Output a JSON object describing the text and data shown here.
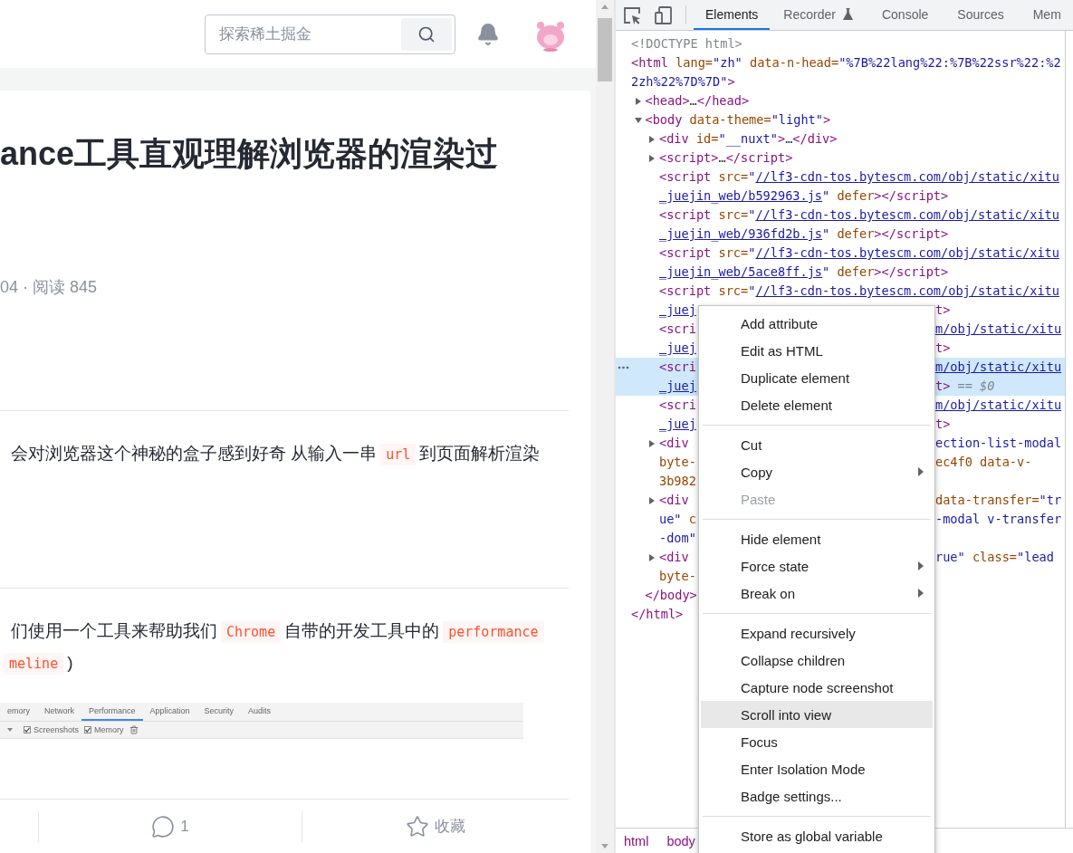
{
  "page": {
    "search": {
      "placeholder": "探索稀土掘金"
    },
    "article": {
      "title": "ance工具直观理解浏览器的渲染过",
      "meta": "04 · 阅读 845",
      "paragraphs": [
        {
          "lines": [
            [
              {
                "kind": "text",
                "text": "会对浏览器这个神秘的盒子感到好奇 从输入一串"
              },
              {
                "kind": "code",
                "text": "url"
              },
              {
                "kind": "text",
                "text": "到页面解析渲染"
              }
            ]
          ]
        },
        {
          "lines": [
            [
              {
                "kind": "text",
                "text": "们使用一个工具来帮助我们"
              },
              {
                "kind": "code",
                "text": "Chrome"
              },
              {
                "kind": "text",
                "text": "自带的开发工具中的"
              },
              {
                "kind": "code",
                "text": "performance"
              }
            ],
            [
              {
                "kind": "code",
                "text": "meline"
              },
              {
                "kind": "text",
                "text": ")"
              }
            ]
          ]
        }
      ],
      "embedded_screenshot": {
        "tabs": [
          {
            "label": "emory",
            "selected": false
          },
          {
            "label": "Network",
            "selected": false
          },
          {
            "label": "Performance",
            "selected": true
          },
          {
            "label": "Application",
            "selected": false
          },
          {
            "label": "Security",
            "selected": false
          },
          {
            "label": "Audits",
            "selected": false
          }
        ],
        "options": [
          {
            "label": "Screenshots",
            "checked": true
          },
          {
            "label": "Memory",
            "checked": true
          }
        ]
      },
      "footer": {
        "comments": "1",
        "collect": "收藏"
      }
    }
  },
  "devtools": {
    "tabs": [
      {
        "label": "Elements",
        "selected": true,
        "kind": "plain"
      },
      {
        "label": "Recorder",
        "selected": false,
        "kind": "experimental"
      },
      {
        "label": "Console",
        "selected": false,
        "kind": "plain"
      },
      {
        "label": "Sources",
        "selected": false,
        "kind": "plain"
      },
      {
        "label": "Mem",
        "selected": false,
        "kind": "plain"
      }
    ],
    "tree": [
      {
        "selected": false,
        "lines": [
          {
            "text": [
              {
                "kind": "doctype",
                "text": "<!DOCTYPE html>"
              }
            ]
          }
        ]
      },
      {
        "selected": false,
        "lines": [
          {
            "text": [
              {
                "kind": "tag",
                "text": "<html"
              },
              {
                "kind": "attr",
                "text": " lang="
              },
              {
                "kind": "value",
                "text": "\"zh\""
              },
              {
                "kind": "attr",
                "text": " data-n-head="
              },
              {
                "kind": "value",
                "text": "\"%7B%22lang%22:%7B%22ssr%22:%2"
              }
            ]
          },
          {
            "text": [
              {
                "kind": "value",
                "text": "2zh%22%7D%7D\""
              },
              {
                "kind": "tag",
                "text": ">"
              }
            ]
          }
        ],
        "children": [
          {
            "expanded": false,
            "selected": false,
            "lines": [
              {
                "text": [
                  {
                    "kind": "tag",
                    "text": "<head>"
                  },
                  {
                    "kind": "plain",
                    "text": "…"
                  },
                  {
                    "kind": "tag",
                    "text": "</head>"
                  }
                ]
              }
            ]
          },
          {
            "expanded": true,
            "selected": false,
            "lines": [
              {
                "text": [
                  {
                    "kind": "tag",
                    "text": "<body"
                  },
                  {
                    "kind": "attr",
                    "text": " data-theme="
                  },
                  {
                    "kind": "value",
                    "text": "\"light\""
                  },
                  {
                    "kind": "tag",
                    "text": ">"
                  }
                ]
              }
            ],
            "children": [
              {
                "expanded": false,
                "selected": false,
                "lines": [
                  {
                    "text": [
                      {
                        "kind": "tag",
                        "text": "<div"
                      },
                      {
                        "kind": "attr",
                        "text": " id="
                      },
                      {
                        "kind": "value",
                        "text": "\"__nuxt\""
                      },
                      {
                        "kind": "tag",
                        "text": ">"
                      },
                      {
                        "kind": "plain",
                        "text": "…"
                      },
                      {
                        "kind": "tag",
                        "text": "</div>"
                      }
                    ]
                  }
                ]
              },
              {
                "expanded": false,
                "selected": false,
                "lines": [
                  {
                    "text": [
                      {
                        "kind": "tag",
                        "text": "<script>"
                      },
                      {
                        "kind": "plain",
                        "text": "…"
                      },
                      {
                        "kind": "tag",
                        "text": "</script>"
                      }
                    ]
                  }
                ]
              },
              {
                "selected": false,
                "lines": [
                  {
                    "text": [
                      {
                        "kind": "tag",
                        "text": "<script"
                      },
                      {
                        "kind": "attr",
                        "text": " src="
                      },
                      {
                        "kind": "value",
                        "text": "\""
                      },
                      {
                        "kind": "link",
                        "text": "//lf3-cdn-tos.bytescm.com/obj/static/xitu"
                      }
                    ]
                  },
                  {
                    "text": [
                      {
                        "kind": "link",
                        "text": "_juejin_web/b592963.js"
                      },
                      {
                        "kind": "value",
                        "text": "\""
                      },
                      {
                        "kind": "attr",
                        "text": " defer"
                      },
                      {
                        "kind": "tag",
                        "text": "></script>"
                      }
                    ]
                  }
                ]
              },
              {
                "selected": false,
                "lines": [
                  {
                    "text": [
                      {
                        "kind": "tag",
                        "text": "<script"
                      },
                      {
                        "kind": "attr",
                        "text": " src="
                      },
                      {
                        "kind": "value",
                        "text": "\""
                      },
                      {
                        "kind": "link",
                        "text": "//lf3-cdn-tos.bytescm.com/obj/static/xitu"
                      }
                    ]
                  },
                  {
                    "text": [
                      {
                        "kind": "link",
                        "text": "_juejin_web/936fd2b.js"
                      },
                      {
                        "kind": "value",
                        "text": "\""
                      },
                      {
                        "kind": "attr",
                        "text": " defer"
                      },
                      {
                        "kind": "tag",
                        "text": "></script>"
                      }
                    ]
                  }
                ]
              },
              {
                "selected": false,
                "lines": [
                  {
                    "text": [
                      {
                        "kind": "tag",
                        "text": "<script"
                      },
                      {
                        "kind": "attr",
                        "text": " src="
                      },
                      {
                        "kind": "value",
                        "text": "\""
                      },
                      {
                        "kind": "link",
                        "text": "//lf3-cdn-tos.bytescm.com/obj/static/xitu"
                      }
                    ]
                  },
                  {
                    "text": [
                      {
                        "kind": "link",
                        "text": "_juejin_web/5ace8ff.js"
                      },
                      {
                        "kind": "value",
                        "text": "\""
                      },
                      {
                        "kind": "attr",
                        "text": " defer"
                      },
                      {
                        "kind": "tag",
                        "text": "></script>"
                      }
                    ]
                  }
                ]
              },
              {
                "selected": false,
                "lines": [
                  {
                    "text": [
                      {
                        "kind": "tag",
                        "text": "<script"
                      },
                      {
                        "kind": "attr",
                        "text": " src="
                      },
                      {
                        "kind": "value",
                        "text": "\""
                      },
                      {
                        "kind": "link",
                        "text": "//lf3-cdn-tos.bytescm.com/obj/static/xitu"
                      }
                    ]
                  },
                  {
                    "text": [
                      {
                        "kind": "link",
                        "text": "_juej"
                      }
                    ],
                    "past_menu": [
                      {
                        "kind": "tag",
                        "text": "t>"
                      }
                    ]
                  }
                ]
              },
              {
                "selected": false,
                "lines": [
                  {
                    "text": [
                      {
                        "kind": "tag",
                        "text": "<scri"
                      }
                    ],
                    "past_menu": [
                      {
                        "kind": "link",
                        "text": "m/obj/static/xitu"
                      }
                    ]
                  },
                  {
                    "text": [
                      {
                        "kind": "link",
                        "text": "_juej"
                      }
                    ],
                    "past_menu": [
                      {
                        "kind": "tag",
                        "text": "t>"
                      }
                    ]
                  }
                ]
              },
              {
                "selected": true,
                "lines": [
                  {
                    "text": [
                      {
                        "kind": "tag",
                        "text": "<scri"
                      }
                    ],
                    "past_menu": [
                      {
                        "kind": "link",
                        "text": "m/obj/static/xitu"
                      }
                    ]
                  },
                  {
                    "text": [
                      {
                        "kind": "link",
                        "text": "_juej"
                      }
                    ],
                    "past_menu": [
                      {
                        "kind": "tag",
                        "text": "t>"
                      },
                      {
                        "kind": "marker",
                        "text": " == $0"
                      }
                    ]
                  }
                ]
              },
              {
                "selected": false,
                "lines": [
                  {
                    "text": [
                      {
                        "kind": "tag",
                        "text": "<scri"
                      }
                    ],
                    "past_menu": [
                      {
                        "kind": "link",
                        "text": "m/obj/static/xitu"
                      }
                    ]
                  },
                  {
                    "text": [
                      {
                        "kind": "link",
                        "text": "_juej"
                      }
                    ],
                    "past_menu": [
                      {
                        "kind": "tag",
                        "text": "t>"
                      }
                    ]
                  }
                ]
              },
              {
                "expanded": false,
                "selected": false,
                "lines": [
                  {
                    "text": [
                      {
                        "kind": "tag",
                        "text": "<div"
                      }
                    ],
                    "past_menu": [
                      {
                        "kind": "value",
                        "text": "ection-list-modal"
                      }
                    ]
                  },
                  {
                    "text": [
                      {
                        "kind": "attr",
                        "text": "byte-"
                      }
                    ],
                    "past_menu": [
                      {
                        "kind": "attr",
                        "text": "ec4f0 data-v-"
                      }
                    ]
                  },
                  {
                    "text": [
                      {
                        "kind": "attr",
                        "text": "3b982"
                      }
                    ]
                  }
                ]
              },
              {
                "expanded": false,
                "selected": false,
                "lines": [
                  {
                    "text": [
                      {
                        "kind": "tag",
                        "text": "<div"
                      }
                    ],
                    "past_menu": [
                      {
                        "kind": "attr",
                        "text": "data-transfer="
                      },
                      {
                        "kind": "value",
                        "text": "\"tr"
                      }
                    ]
                  },
                  {
                    "text": [
                      {
                        "kind": "value",
                        "text": "ue\""
                      },
                      {
                        "kind": "attr",
                        "text": " c"
                      }
                    ],
                    "past_menu": [
                      {
                        "kind": "value",
                        "text": "-modal v-transfer"
                      }
                    ]
                  },
                  {
                    "text": [
                      {
                        "kind": "value",
                        "text": "-dom\""
                      }
                    ]
                  }
                ]
              },
              {
                "expanded": false,
                "selected": false,
                "lines": [
                  {
                    "text": [
                      {
                        "kind": "tag",
                        "text": "<div"
                      }
                    ],
                    "past_menu": [
                      {
                        "kind": "value",
                        "text": "rue\""
                      },
                      {
                        "kind": "attr",
                        "text": " class="
                      },
                      {
                        "kind": "value",
                        "text": "\"lead"
                      }
                    ]
                  },
                  {
                    "text": [
                      {
                        "kind": "attr",
                        "text": "byte-"
                      }
                    ]
                  }
                ]
              }
            ],
            "closing": [
              {
                "kind": "tag",
                "text": "</body>"
              }
            ]
          }
        ],
        "closing": [
          {
            "kind": "tag",
            "text": "</html>"
          }
        ]
      }
    ],
    "breadcrumbs": [
      "html",
      "body"
    ],
    "context_menu": [
      {
        "kind": "item",
        "label": "Add attribute",
        "submenu": false,
        "disabled": false,
        "selected": false
      },
      {
        "kind": "item",
        "label": "Edit as HTML",
        "submenu": false,
        "disabled": false,
        "selected": false
      },
      {
        "kind": "item",
        "label": "Duplicate element",
        "submenu": false,
        "disabled": false,
        "selected": false
      },
      {
        "kind": "item",
        "label": "Delete element",
        "submenu": false,
        "disabled": false,
        "selected": false
      },
      {
        "kind": "separator"
      },
      {
        "kind": "item",
        "label": "Cut",
        "submenu": false,
        "disabled": false,
        "selected": false
      },
      {
        "kind": "item",
        "label": "Copy",
        "submenu": true,
        "disabled": false,
        "selected": false
      },
      {
        "kind": "item",
        "label": "Paste",
        "submenu": false,
        "disabled": true,
        "selected": false
      },
      {
        "kind": "separator"
      },
      {
        "kind": "item",
        "label": "Hide element",
        "submenu": false,
        "disabled": false,
        "selected": false
      },
      {
        "kind": "item",
        "label": "Force state",
        "submenu": true,
        "disabled": false,
        "selected": false
      },
      {
        "kind": "item",
        "label": "Break on",
        "submenu": true,
        "disabled": false,
        "selected": false
      },
      {
        "kind": "separator"
      },
      {
        "kind": "item",
        "label": "Expand recursively",
        "submenu": false,
        "disabled": false,
        "selected": false
      },
      {
        "kind": "item",
        "label": "Collapse children",
        "submenu": false,
        "disabled": false,
        "selected": false
      },
      {
        "kind": "item",
        "label": "Capture node screenshot",
        "submenu": false,
        "disabled": false,
        "selected": false
      },
      {
        "kind": "item",
        "label": "Scroll into view",
        "submenu": false,
        "disabled": false,
        "selected": true
      },
      {
        "kind": "item",
        "label": "Focus",
        "submenu": false,
        "disabled": false,
        "selected": false
      },
      {
        "kind": "item",
        "label": "Enter Isolation Mode",
        "submenu": false,
        "disabled": false,
        "selected": false
      },
      {
        "kind": "item",
        "label": "Badge settings...",
        "submenu": false,
        "disabled": false,
        "selected": false
      },
      {
        "kind": "separator"
      },
      {
        "kind": "item",
        "label": "Store as global variable",
        "submenu": false,
        "disabled": false,
        "selected": false
      }
    ]
  }
}
